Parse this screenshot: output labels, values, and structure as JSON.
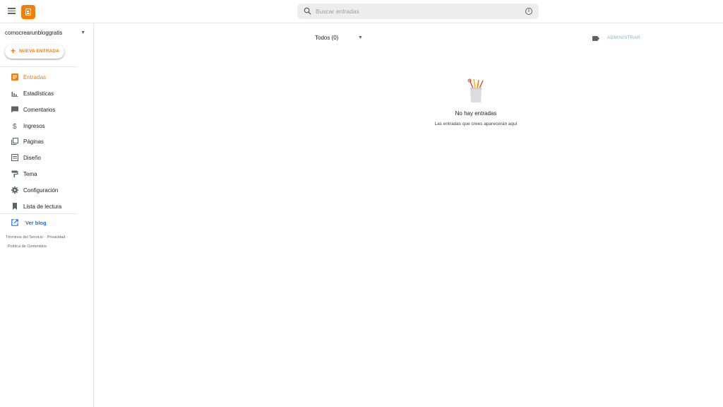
{
  "header": {
    "search_placeholder": "Buscar entradas"
  },
  "sidebar": {
    "blog_name": "comocrearunbloggratis",
    "new_post_label": "NUEVA ENTRADA",
    "items": [
      {
        "label": "Entradas",
        "icon": "posts-icon",
        "active": true
      },
      {
        "label": "Estadísticas",
        "icon": "stats-icon"
      },
      {
        "label": "Comentarios",
        "icon": "comments-icon"
      },
      {
        "label": "Ingresos",
        "icon": "earnings-icon"
      },
      {
        "label": "Páginas",
        "icon": "pages-icon"
      },
      {
        "label": "Diseño",
        "icon": "layout-icon"
      },
      {
        "label": "Tema",
        "icon": "theme-icon"
      },
      {
        "label": "Configuración",
        "icon": "gear-icon"
      },
      {
        "label": "Lista de lectura",
        "icon": "bookmark-icon"
      }
    ],
    "view_blog_label": "Ver blog",
    "footer": {
      "terms": "Términos del Servicio",
      "privacy": "Privacidad",
      "content_policy": "Política de Contenidos"
    }
  },
  "main": {
    "filter_label": "Todos (0)",
    "manage_label": "ADMINISTRAR",
    "empty_title": "No hay entradas",
    "empty_subtitle": "Las entradas que crees aparecerán aquí"
  },
  "colors": {
    "accent": "#f57d00",
    "link": "#1a73e8",
    "muted": "#5f6368"
  }
}
